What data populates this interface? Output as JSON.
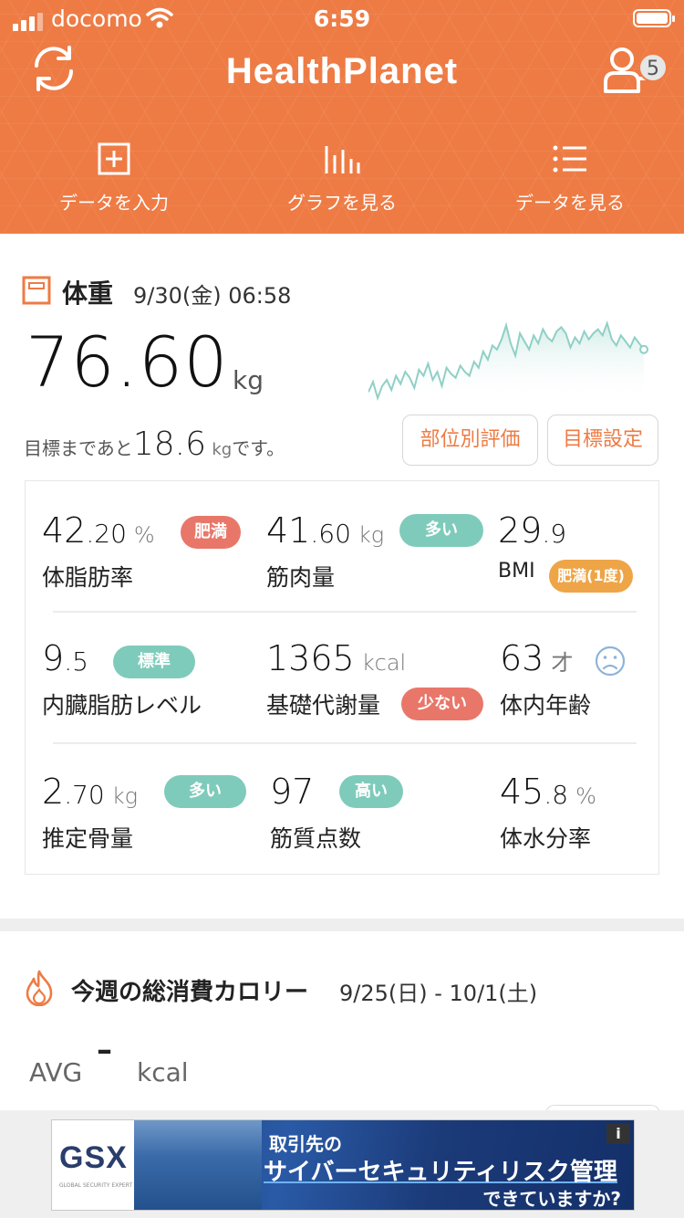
{
  "status_bar": {
    "carrier": "docomo",
    "time": "6:59"
  },
  "header": {
    "app_title": "HealthPlanet",
    "notification_count": "5",
    "nav": [
      {
        "label": "データを入力",
        "icon": "add-data-icon"
      },
      {
        "label": "グラフを見る",
        "icon": "bar-graph-icon"
      },
      {
        "label": "データを見る",
        "icon": "list-icon"
      }
    ]
  },
  "weight": {
    "title": "体重",
    "measured_at": "9/30(金) 06:58",
    "value": "76.60",
    "unit": "kg",
    "goal_prefix": "目標まであと",
    "goal_remaining": "18.6",
    "goal_unit": "kg",
    "goal_suffix": "です。",
    "buttons": {
      "evaluation": "部位別評価",
      "goal_setting": "目標設定"
    },
    "trend": [
      62,
      67,
      59,
      65,
      68,
      63,
      70,
      66,
      72,
      69,
      64,
      73,
      70,
      76,
      68,
      72,
      65,
      74,
      71,
      69,
      75,
      72,
      70,
      77,
      74,
      82,
      78,
      85,
      83,
      88,
      95,
      86,
      80,
      91,
      87,
      83,
      90,
      86,
      93,
      89,
      87,
      92,
      94,
      91,
      84,
      89,
      86,
      92,
      88,
      91,
      93,
      90,
      96,
      88,
      85,
      90,
      87,
      84,
      89,
      86,
      83
    ]
  },
  "metrics": [
    {
      "label": "体脂肪率",
      "int": "42",
      "dec": ".20",
      "unit": "%",
      "badge": "肥満",
      "badge_color": "red"
    },
    {
      "label": "筋肉量",
      "int": "41",
      "dec": ".60",
      "unit": "kg",
      "badge": "多い",
      "badge_color": "teal"
    },
    {
      "label": "BMI",
      "int": "29",
      "dec": ".9",
      "unit": "",
      "badge": "肥満(1度)",
      "badge_color": "amber"
    },
    {
      "label": "内臓脂肪レベル",
      "int": "9",
      "dec": ".5",
      "unit": "",
      "badge": "標準",
      "badge_color": "teal"
    },
    {
      "label": "基礎代謝量",
      "int": "1365",
      "dec": "",
      "unit": "kcal",
      "badge": "少ない",
      "badge_color": "red"
    },
    {
      "label": "体内年齢",
      "int": "63",
      "dec": "",
      "unit": "才",
      "badge": "",
      "badge_color": ""
    },
    {
      "label": "推定骨量",
      "int": "2",
      "dec": ".70",
      "unit": "kg",
      "badge": "多い",
      "badge_color": "teal"
    },
    {
      "label": "筋質点数",
      "int": "97",
      "dec": "",
      "unit": "",
      "badge": "高い",
      "badge_color": "teal"
    },
    {
      "label": "体水分率",
      "int": "45",
      "dec": ".8",
      "unit": "%",
      "badge": "",
      "badge_color": ""
    }
  ],
  "calories": {
    "title": "今週の総消費カロリー",
    "range": "9/25(日) - 10/1(土)",
    "avg_label": "AVG",
    "avg_value": "–",
    "unit": "kcal"
  },
  "ad": {
    "logo": "GSX",
    "logo_sub": "GLOBAL SECURITY EXPERT",
    "line1": "取引先の",
    "line2": "サイバーセキュリティリスク管理",
    "line3": "できていますか?",
    "info": "i"
  },
  "colors": {
    "brand_orange": "#ee7b44",
    "badge_red": "#e8776a",
    "badge_teal": "#7fcbbb",
    "badge_amber": "#eea547",
    "chart_line": "#8fd0c6"
  }
}
